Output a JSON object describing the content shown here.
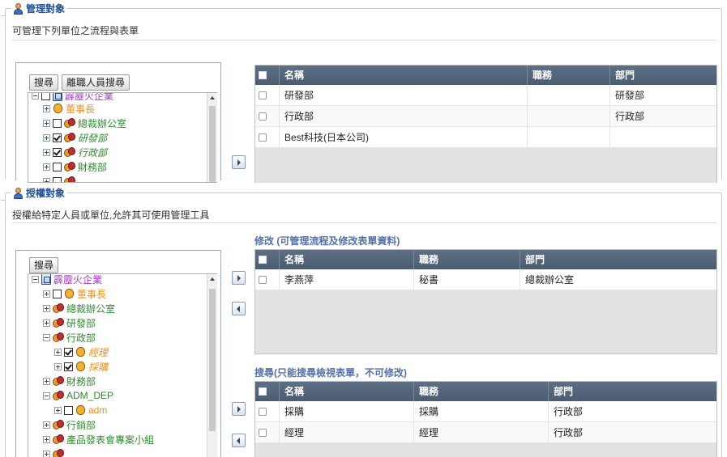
{
  "manage_section": {
    "title": "管理對象",
    "description": "可管理下列單位之流程與表單",
    "search_button": "搜尋",
    "resigned_search_button": "離職人員搜尋",
    "tree": [
      {
        "label": "霹靂火企業",
        "style": "purple"
      },
      {
        "label": "董事長",
        "style": "orange"
      },
      {
        "label": "總裁辦公室",
        "style": "green"
      },
      {
        "label": "研發部",
        "style": "green-i"
      },
      {
        "label": "行政部",
        "style": "green-i"
      },
      {
        "label": "財務部",
        "style": "green"
      }
    ],
    "grid": {
      "headers": [
        "名稱",
        "職務",
        "部門"
      ],
      "rows": [
        {
          "name": "研發部",
          "title": "",
          "dept": "研發部"
        },
        {
          "name": "行政部",
          "title": "",
          "dept": "行政部"
        },
        {
          "name": "Best科技(日本公司)",
          "title": "",
          "dept": ""
        }
      ]
    }
  },
  "auth_section": {
    "title": "授權對象",
    "description": "授權給特定人員或單位,允許其可使用管理工具",
    "search_button": "搜尋",
    "tree": [
      {
        "label": "霹靂火企業",
        "style": "purple"
      },
      {
        "label": "董事長",
        "style": "orange"
      },
      {
        "label": "總裁辦公室",
        "style": "green"
      },
      {
        "label": "研發部",
        "style": "green"
      },
      {
        "label": "行政部",
        "style": "green"
      },
      {
        "label": "經理",
        "style": "orange-i"
      },
      {
        "label": "採購",
        "style": "orange-i"
      },
      {
        "label": "財務部",
        "style": "green"
      },
      {
        "label": "ADM_DEP",
        "style": "green"
      },
      {
        "label": "adm",
        "style": "orange"
      },
      {
        "label": "行銷部",
        "style": "green"
      },
      {
        "label": "產品發表會專案小組",
        "style": "green"
      }
    ],
    "modify_grid": {
      "caption": "修改 (可管理流程及修改表單資料)",
      "headers": [
        "名稱",
        "職務",
        "部門"
      ],
      "rows": [
        {
          "name": "李燕萍",
          "title": "秘書",
          "dept": "總裁辦公室"
        }
      ]
    },
    "search_grid": {
      "caption": "搜尋(只能搜尋檢視表單，不可修改)",
      "headers": [
        "名稱",
        "職務",
        "部門"
      ],
      "rows": [
        {
          "name": "採購",
          "title": "採購",
          "dept": "行政部"
        },
        {
          "name": "經理",
          "title": "經理",
          "dept": "行政部"
        }
      ]
    }
  },
  "colors": {
    "title_blue": "#1d4f9c",
    "grid_header": "#4f6075",
    "caption_blue": "#5572a8",
    "tree_purple": "#a23cc8",
    "tree_orange": "#e8901e",
    "tree_green": "#2e8a2e"
  }
}
